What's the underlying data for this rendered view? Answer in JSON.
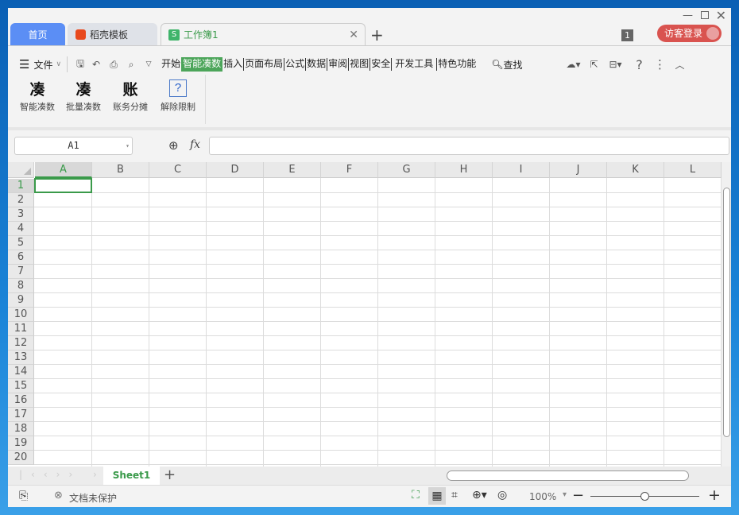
{
  "tabs": [
    {
      "label": "首页"
    },
    {
      "label": "稻壳模板"
    },
    {
      "label": "工作簿1"
    }
  ],
  "header": {
    "badge": "1",
    "login": "访客登录"
  },
  "menu": {
    "file": "文件",
    "tabs": [
      "开始",
      "智能凑数",
      "插入",
      "页面布局",
      "公式",
      "数据",
      "审阅",
      "视图",
      "安全",
      "开发工具",
      "特色功能"
    ],
    "active": 1,
    "search": "查找"
  },
  "ribbon": [
    {
      "glyph": "凑",
      "label": "智能凑数"
    },
    {
      "glyph": "凑",
      "label": "批量凑数"
    },
    {
      "glyph": "账",
      "label": "账务分摊"
    },
    {
      "glyph": "?",
      "label": "解除限制"
    }
  ],
  "formula": {
    "namebox": "A1",
    "fx": "fx",
    "value": ""
  },
  "columns": [
    "A",
    "B",
    "C",
    "D",
    "E",
    "F",
    "G",
    "H",
    "I",
    "J",
    "K",
    "L"
  ],
  "rows": [
    "1",
    "2",
    "3",
    "4",
    "5",
    "6",
    "7",
    "8",
    "9",
    "10",
    "11",
    "12",
    "13",
    "14",
    "15",
    "16",
    "17",
    "18",
    "19",
    "20"
  ],
  "sheets": {
    "active": "Sheet1"
  },
  "status": {
    "protect": "文档未保护",
    "zoom": "100%"
  },
  "colors": {
    "accent": "#4ca55a",
    "tab_home": "#5b8ef5",
    "login": "#d9534f"
  }
}
